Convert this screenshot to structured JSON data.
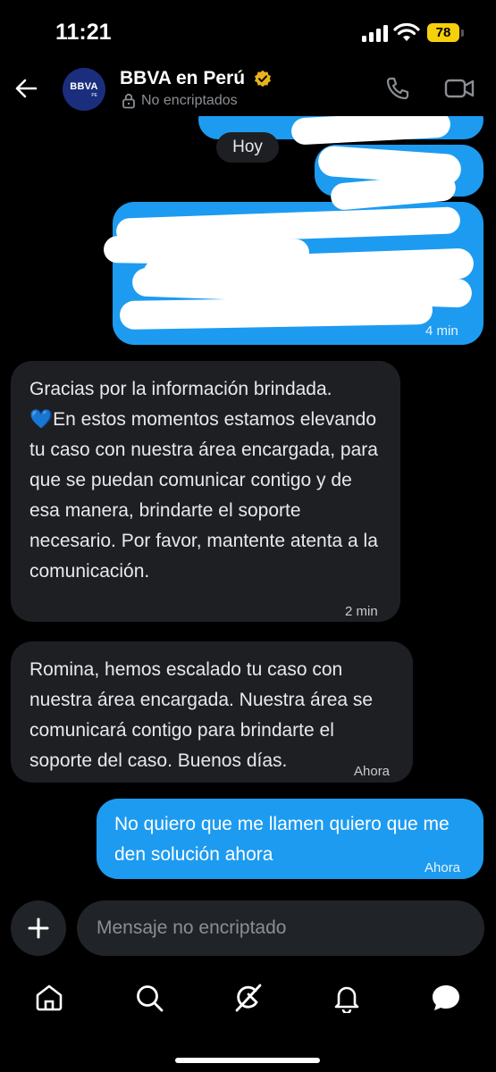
{
  "status_bar": {
    "time": "11:21",
    "battery": "78"
  },
  "header": {
    "avatar_text": "BBVA",
    "avatar_sub": "PE",
    "title": "BBVA en Perú",
    "subtitle": "No encriptados",
    "icons": [
      "back-arrow-icon",
      "verified-badge-icon",
      "lock-icon",
      "phone-icon",
      "video-call-icon"
    ]
  },
  "chat": {
    "day_separator": "Hoy",
    "messages": [
      {
        "direction": "in",
        "text": "Gracias por la información brindada.\n💙En estos momentos estamos elevando tu caso con nuestra área encargada, para que se puedan comunicar contigo y de esa manera, brindarte el soporte necesario. Por favor, mantente atenta a la comunicación.",
        "time": "2 min"
      },
      {
        "direction": "in",
        "text": "Romina, hemos escalado tu caso con nuestra área encargada. Nuestra área se comunicará contigo para brindarte el soporte del caso. Buenos días.",
        "time": "Ahora"
      },
      {
        "direction": "out",
        "text": "No quiero que me llamen quiero que me den solución ahora",
        "time": "Ahora"
      }
    ],
    "redacted_time": "4 min"
  },
  "composer": {
    "placeholder": "Mensaje no encriptado"
  },
  "nav": {
    "items": [
      "home-icon",
      "search-icon",
      "grok-icon",
      "notifications-icon",
      "messages-icon"
    ]
  },
  "colors": {
    "background": "#000000",
    "outgoing_bubble": "#1d9bf0",
    "incoming_bubble": "#1d1f23",
    "verified": "#e8b21c",
    "avatar": "#1b2e7d"
  }
}
